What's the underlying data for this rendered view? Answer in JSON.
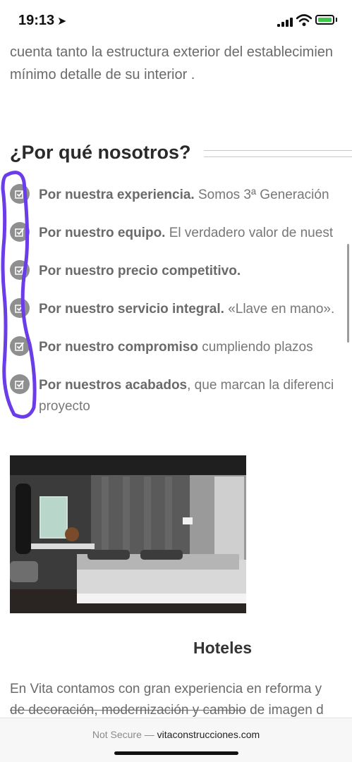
{
  "status_bar": {
    "time": "19:13",
    "battery_color": "#3cc84b",
    "icons": [
      "location-arrow-icon",
      "signal-icon",
      "wifi-icon",
      "battery-charging-icon"
    ]
  },
  "intro": {
    "line1": "cuenta tanto la estructura exterior del establecimien",
    "line2": "mínimo detalle de su interior ."
  },
  "why_us": {
    "title": "¿Por qué nosotros?",
    "items": [
      {
        "bold": "Por nuestra experiencia.",
        "rest": " Somos 3ª Generación"
      },
      {
        "bold": "Por nuestro equipo.",
        "rest": " El verdadero valor de nuest"
      },
      {
        "bold": "Por nuestro precio competitivo.",
        "rest": ""
      },
      {
        "bold": "Por nuestro servicio integral.",
        "rest": " «Llave en mano»."
      },
      {
        "bold": "Por nuestro compromiso",
        "rest": " cumpliendo plazos"
      },
      {
        "bold": "Por nuestros acabados",
        "rest": ", que marcan la diferenci",
        "rest_line2": "proyecto"
      }
    ],
    "icon": "checkbox-icon",
    "annotation_color": "#6a3de8"
  },
  "hotel": {
    "title": "Hoteles",
    "text_line1": "En Vita contamos con gran experiencia en reforma y",
    "text_line2_struck": "de decoración, modernización y cambio",
    "text_line2_rest": " de imagen d"
  },
  "address_bar": {
    "not_secure": "Not Secure —",
    "domain": "vitaconstrucciones.com"
  }
}
